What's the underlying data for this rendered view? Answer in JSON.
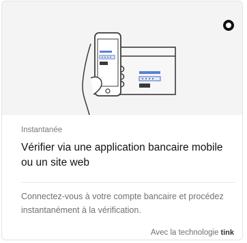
{
  "option": {
    "category": "Instantanée",
    "title": "Vérifier via une application bancaire mobile ou un site web",
    "description": "Connectez-vous à votre compte bancaire et procédez instantanément à la vérification.",
    "footer_prefix": "Avec la technologie",
    "provider": "tink",
    "selected": false,
    "illustration_icon": "phone-banking-illustration",
    "selector_icon": "radio-button-icon"
  }
}
